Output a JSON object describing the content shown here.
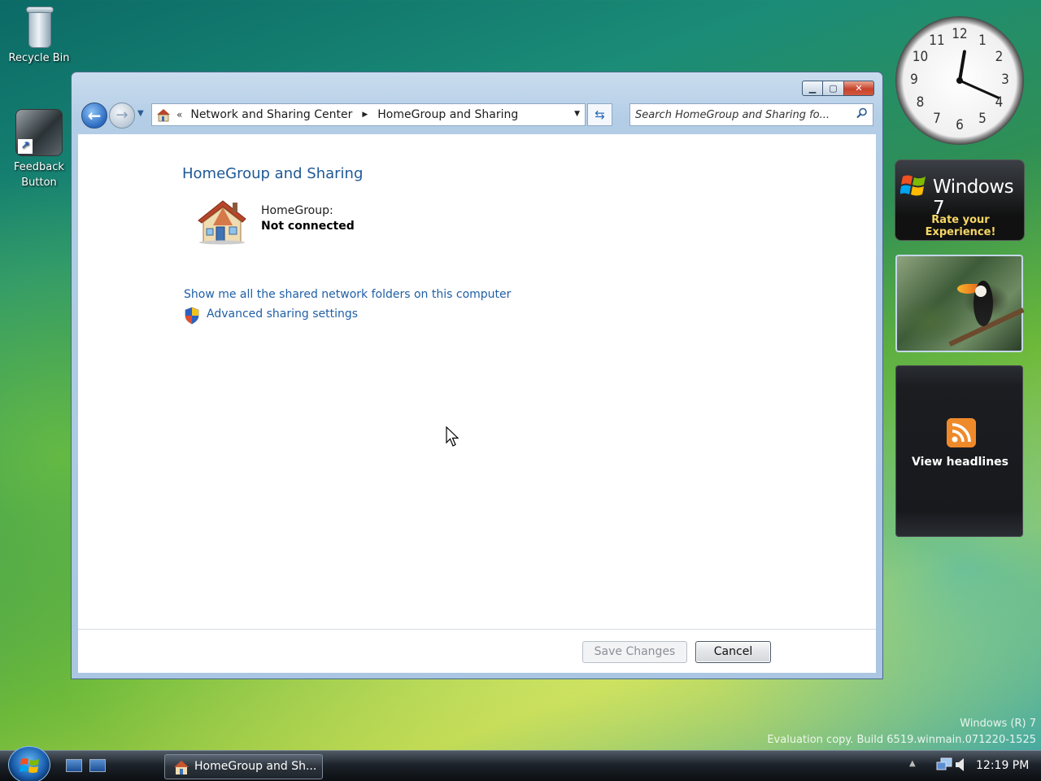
{
  "desktop": {
    "icons": [
      {
        "label": "Recycle Bin"
      },
      {
        "label": "Feedback Button"
      }
    ],
    "watermark": {
      "line1": "Windows (R) 7",
      "line2": "Evaluation copy. Build 6519.winmain.071220-1525"
    }
  },
  "window": {
    "title": "HomeGroup and Sharing",
    "breadcrumb": [
      "Network and Sharing Center",
      "HomeGroup and Sharing"
    ],
    "breadcrumb_overflow": "«",
    "search_placeholder": "Search HomeGroup and Sharing fo...",
    "page_title": "HomeGroup and Sharing",
    "homegroup_label": "HomeGroup:",
    "homegroup_status": "Not connected",
    "links": {
      "shared_folders": "Show me all the shared network folders on this computer",
      "advanced_sharing": "Advanced sharing settings"
    },
    "buttons": {
      "save": "Save Changes",
      "cancel": "Cancel"
    }
  },
  "gadgets": {
    "clock": {
      "numbers": [
        "12",
        "1",
        "2",
        "3",
        "4",
        "5",
        "6",
        "7",
        "8",
        "9",
        "10",
        "11"
      ],
      "time_hour": 12,
      "time_minute": 19
    },
    "windows7": {
      "title": "Windows 7",
      "subtitle": "Rate your Experience!"
    },
    "feeds": {
      "label": "View headlines"
    }
  },
  "taskbar": {
    "task_label": "HomeGroup and Sh...",
    "time": "12:19 PM"
  },
  "colors": {
    "link": "#1f5fa6",
    "title": "#1e5896",
    "window_frame": "#b3cde6"
  }
}
